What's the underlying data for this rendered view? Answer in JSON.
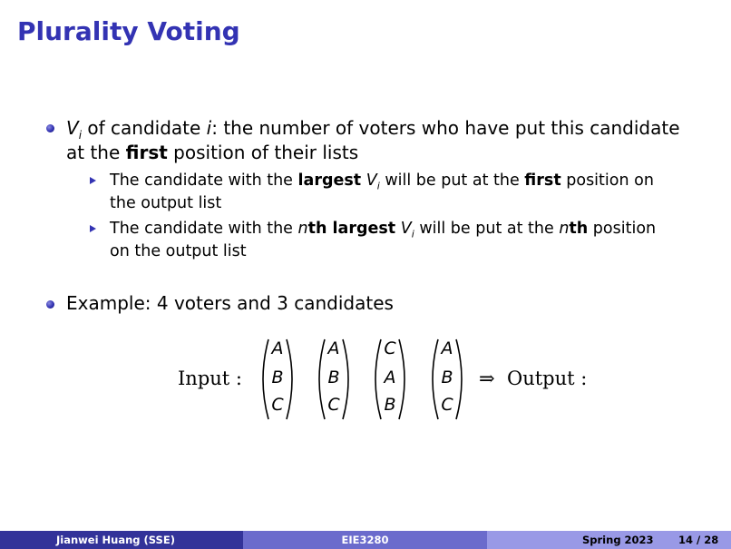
{
  "slide": {
    "title": "Plurality Voting",
    "bullet1": {
      "var": "V",
      "sub_i": "i",
      "text_a": " of candidate ",
      "var_i": "i",
      "text_b": ": the number of voters who have put this candidate",
      "line2_a": "at the ",
      "line2_bold": "first",
      "line2_b": " position of their lists"
    },
    "sub1": {
      "text_a": "The candidate with the ",
      "bold_a": "largest",
      "var": "V",
      "sub_i": "i",
      "text_b": " will be put at the ",
      "bold_b": "first",
      "text_c": " position on",
      "line2": "the output list"
    },
    "sub2": {
      "text_a": "The candidate with the ",
      "var_n": "n",
      "bold_th": "th largest",
      "var": "V",
      "sub_i": "i",
      "text_b": " will be put at the ",
      "var_n2": "n",
      "bold_th2": "th",
      "text_c": " position",
      "line2": "on the output list"
    },
    "bullet2": "Example: 4 voters and 3 candidates",
    "example": {
      "input_label": "Input :",
      "arrow": "⇒",
      "output_label": "Output :",
      "ballots": [
        [
          "A",
          "B",
          "C"
        ],
        [
          "A",
          "B",
          "C"
        ],
        [
          "C",
          "A",
          "B"
        ],
        [
          "A",
          "B",
          "C"
        ]
      ]
    }
  },
  "footer": {
    "author": "Jianwei Huang  (SSE)",
    "course": "EIE3280",
    "term": "Spring 2023",
    "page": "14 / 28",
    "colors": {
      "left": "#333399",
      "middle": "#6b6bcc",
      "right": "#9999e6"
    }
  },
  "colors": {
    "title": "#3333b3",
    "bullet": "#3333b3"
  }
}
